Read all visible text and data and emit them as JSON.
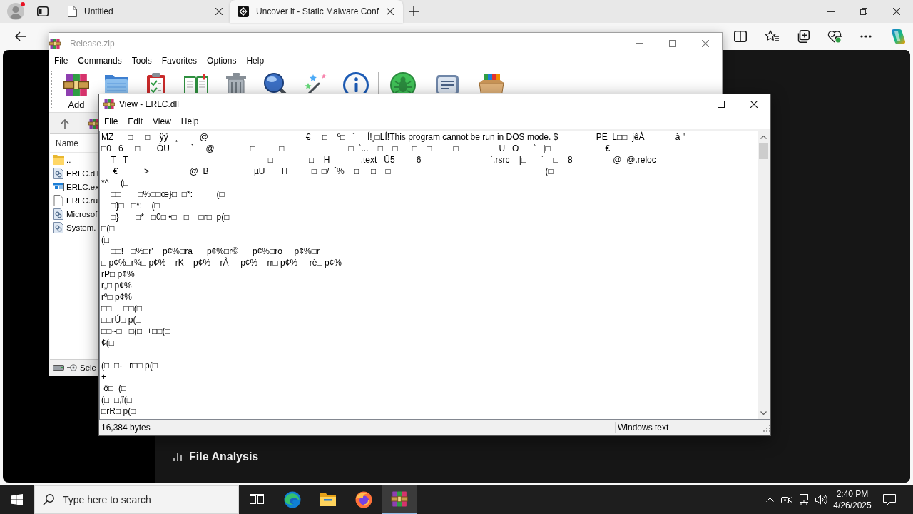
{
  "browser": {
    "tabs": [
      {
        "kind": "document",
        "title": "Untitled",
        "selected": false
      },
      {
        "kind": "site",
        "title": "Uncover it - Static Malware Conf",
        "selected": true
      }
    ]
  },
  "page": {
    "section_title": "File Analysis"
  },
  "archive_window": {
    "title": "Release.zip",
    "menu": [
      "File",
      "Commands",
      "Tools",
      "Favorites",
      "Options",
      "Help"
    ],
    "toolbar_groups": [
      [
        {
          "kind": "add",
          "label": "Add"
        },
        {
          "kind": "extract"
        },
        {
          "kind": "test"
        },
        {
          "kind": "view"
        },
        {
          "kind": "delete"
        },
        {
          "kind": "find"
        },
        {
          "kind": "wizard"
        },
        {
          "kind": "info"
        }
      ],
      [
        {
          "kind": "scan"
        },
        {
          "kind": "comment"
        },
        {
          "kind": "sfx"
        }
      ]
    ],
    "file_list": {
      "columns": [
        "Name"
      ],
      "rows": [
        {
          "kind": "parent",
          "name": ".."
        },
        {
          "kind": "library",
          "name": "ERLC.dll"
        },
        {
          "kind": "program",
          "name": "ERLC.ex"
        },
        {
          "kind": "file",
          "name": "ERLC.ru"
        },
        {
          "kind": "library",
          "name": "Microsof"
        },
        {
          "kind": "library",
          "name": "System."
        }
      ]
    },
    "status_bar": "Sele"
  },
  "viewer_window": {
    "title": "View - ERLC.dll",
    "menu": [
      "File",
      "Edit",
      "View",
      "Help"
    ],
    "content": "MZ      □     □    ÿÿ   ¸         @                                         €     □    º□   ´     Í!¸□LÍ!This program cannot be run in DOS mode. $                PE  L□□  jêÀ             à \"\n□0   6     □       ÒU         `     @               □          □                           □  `...    □    □      □    □         □                 U   O      `   |□                       €\n    T   T                                                           □               □    H             .text   Ü5         6                             `.rsrc    |□      `    □    8                 @  @.reloc\n     €           >                 @  B                   µU       H          □  □/  ˆ%    □     □    □                                                                 (□\n*^     (□\n    □□       □%□□œ}□  □*:          (□\n    □}□   □*:    (□\n    □}       □*   □0□ •□   □    □r□  p(□\n□(□\n(□\n    □□!   □%□r'    p¢%□ra      p¢%□r©      p¢%□rõ     p¢%□r\n□ p¢%□r¾□ p¢%    rK    p¢%    rÅ     p¢%    rr□ p¢%     rè□ p¢%\nrP□ p¢%\nr„□ p¢%\nrº□ p¢%\n□□     □□(□\n□□rÚ□ p(□\n□□~□   □(□  +□□(□\n¢(□\n\n(□  □-   r□□ p(□\n+\n ô□  (□\n(□  □,ï(□\n□rR□ p(□",
    "status_bar": [
      "16,384 bytes",
      "Windows text"
    ]
  },
  "taskbar": {
    "search": {
      "placeholder": "Type here to search"
    },
    "apps": [
      {
        "kind": "task-view",
        "selected": false
      },
      {
        "kind": "browser",
        "selected": false
      },
      {
        "kind": "files",
        "selected": false
      },
      {
        "kind": "firefox",
        "selected": false
      },
      {
        "kind": "archiver",
        "selected": true
      }
    ],
    "clock": {
      "time": "2:40 PM",
      "date": "4/26/2025"
    }
  }
}
